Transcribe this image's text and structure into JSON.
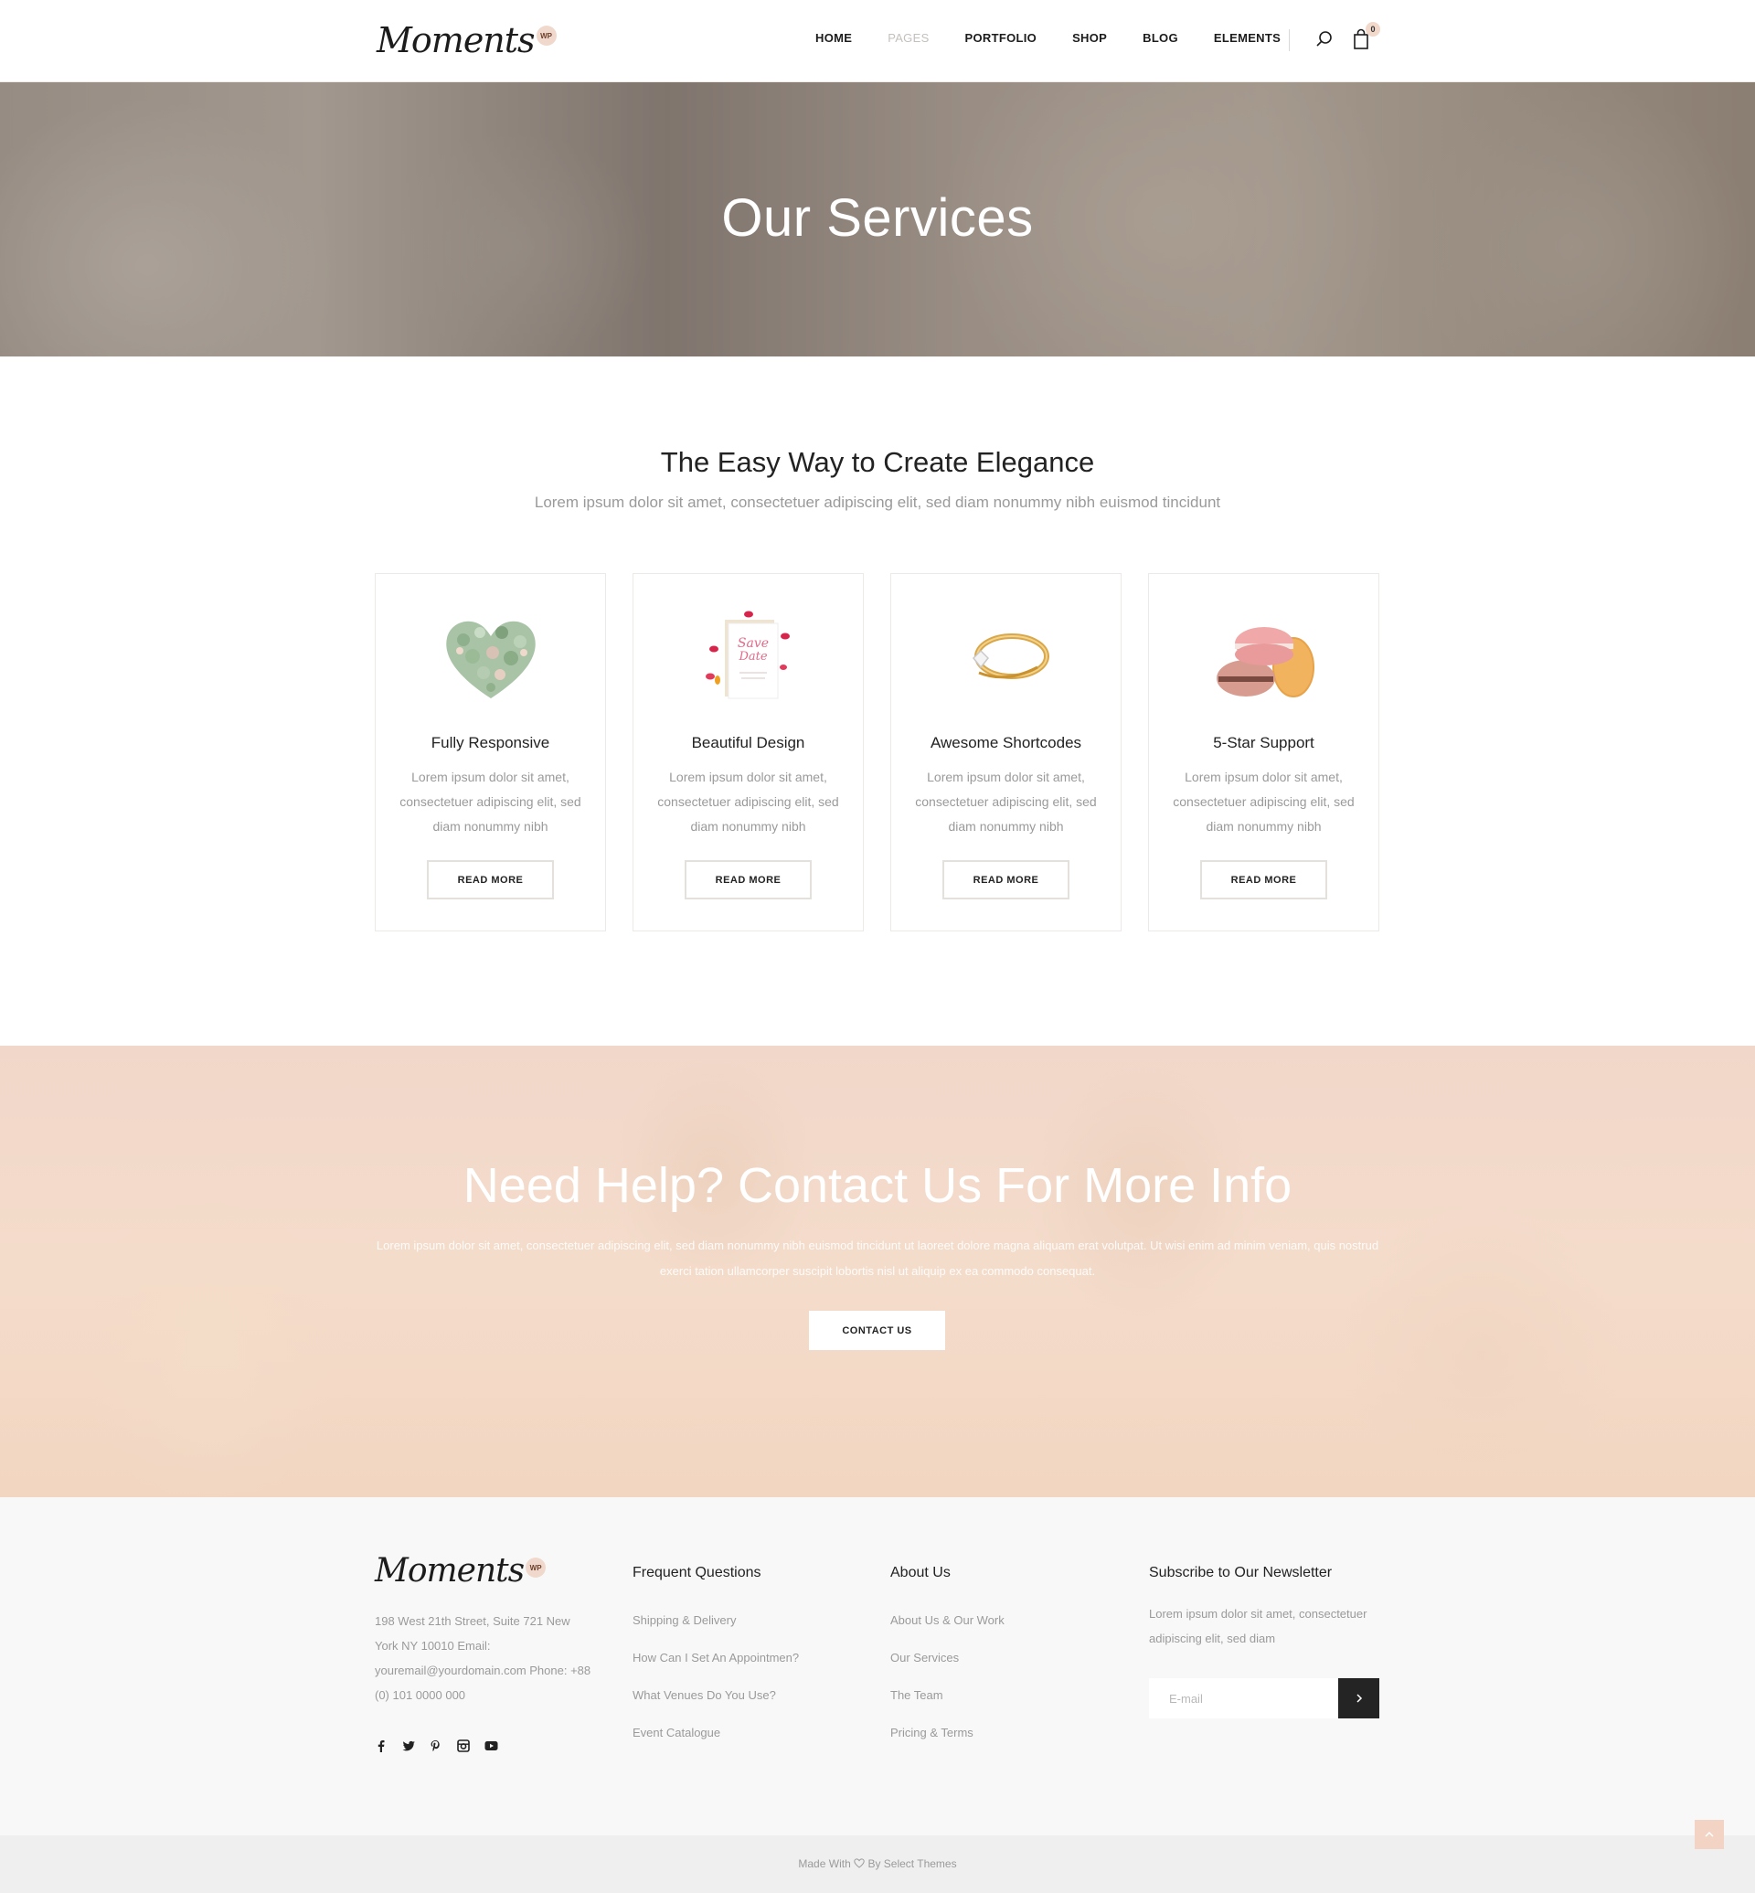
{
  "header": {
    "logo_text": "Moments",
    "logo_badge": "WP",
    "nav": [
      {
        "label": "HOME",
        "muted": false
      },
      {
        "label": "PAGES",
        "muted": true
      },
      {
        "label": "PORTFOLIO",
        "muted": false
      },
      {
        "label": "SHOP",
        "muted": false
      },
      {
        "label": "BLOG",
        "muted": false
      },
      {
        "label": "ELEMENTS",
        "muted": false
      }
    ],
    "cart_count": "0",
    "icons": [
      "search-icon",
      "shopping-bag-icon"
    ]
  },
  "hero": {
    "title": "Our Services"
  },
  "intro": {
    "title": "The Easy Way to Create Elegance",
    "subtitle": "Lorem ipsum dolor sit amet, consectetuer adipiscing elit, sed diam nonummy nibh euismod tincidunt"
  },
  "cards": [
    {
      "title": "Fully Responsive",
      "text": "Lorem ipsum dolor sit amet, consectetuer adipiscing elit, sed diam nonummy nibh",
      "button": "READ MORE",
      "image": "leaf-heart-image"
    },
    {
      "title": "Beautiful Design",
      "text": "Lorem ipsum dolor sit amet, consectetuer adipiscing elit, sed diam nonummy nibh",
      "button": "READ MORE",
      "image": "save-the-date-card-image",
      "image_text_1": "Save",
      "image_text_2": "Date"
    },
    {
      "title": "Awesome Shortcodes",
      "text": "Lorem ipsum dolor sit amet, consectetuer adipiscing elit, sed diam nonummy nibh",
      "button": "READ MORE",
      "image": "ring-image"
    },
    {
      "title": "5-Star Support",
      "text": "Lorem ipsum dolor sit amet, consectetuer adipiscing elit, sed diam nonummy nibh",
      "button": "READ MORE",
      "image": "macarons-image"
    }
  ],
  "contact": {
    "title": "Need Help? Contact Us For More Info",
    "text": "Lorem ipsum dolor sit amet, consectetuer adipiscing elit, sed diam nonummy nibh euismod tincidunt ut laoreet dolore magna aliquam erat volutpat. Ut wisi enim ad minim veniam, quis nostrud exerci tation ullamcorper suscipit lobortis nisl ut aliquip ex ea commodo consequat.",
    "button": "CONTACT US"
  },
  "footer": {
    "logo_text": "Moments",
    "logo_badge": "WP",
    "address": "198 West 21th Street, Suite 721 New York NY 10010 Email: youremail@yourdomain.com Phone: +88 (0) 101 0000 000",
    "social_icons": [
      "facebook-icon",
      "twitter-icon",
      "pinterest-icon",
      "instagram-icon",
      "youtube-icon"
    ],
    "col1": {
      "title": "Frequent Questions",
      "links": [
        "Shipping & Delivery",
        "How Can I Set An Appointmen?",
        "What Venues Do You Use?",
        "Event Catalogue"
      ]
    },
    "col2": {
      "title": "About Us",
      "links": [
        "About Us & Our Work",
        "Our Services",
        "The Team",
        "Pricing & Terms"
      ]
    },
    "newsletter": {
      "title": "Subscribe to Our Newsletter",
      "text": "Lorem ipsum dolor sit amet, consectetuer adipiscing elit, sed diam",
      "placeholder": "E-mail"
    }
  },
  "bottom": {
    "made_with": "Made With",
    "by": "By Select Themes"
  },
  "colors": {
    "accent": "#f2d3c4",
    "dark": "#242424",
    "muted_text": "#9a9a9a"
  }
}
